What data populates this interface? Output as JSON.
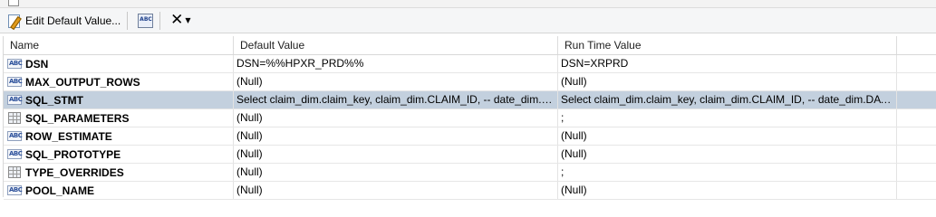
{
  "toolbar": {
    "edit_default_label": "Edit Default Value...",
    "abc_icon_text": "ABC"
  },
  "columns": {
    "name": "Name",
    "default_value": "Default Value",
    "run_time_value": "Run Time Value"
  },
  "type_icon_text": "ABC",
  "rows": [
    {
      "name": "DSN",
      "type": "string",
      "default": "DSN=%%HPXR_PRD%%",
      "runtime": "DSN=XRPRD"
    },
    {
      "name": "MAX_OUTPUT_ROWS",
      "type": "string",
      "default": "(Null)",
      "runtime": "(Null)"
    },
    {
      "name": "SQL_STMT",
      "type": "string",
      "default": "Select claim_dim.claim_key, claim_dim.CLAIM_ID, -- date_dim.DA...",
      "runtime": "Select claim_dim.claim_key, claim_dim.CLAIM_ID, -- date_dim.DATE_...",
      "selected": true
    },
    {
      "name": "SQL_PARAMETERS",
      "type": "table",
      "default": "(Null)",
      "runtime": ";"
    },
    {
      "name": "ROW_ESTIMATE",
      "type": "string",
      "default": "(Null)",
      "runtime": "(Null)"
    },
    {
      "name": "SQL_PROTOTYPE",
      "type": "string",
      "default": "(Null)",
      "runtime": "(Null)"
    },
    {
      "name": "TYPE_OVERRIDES",
      "type": "table",
      "default": "(Null)",
      "runtime": ";"
    },
    {
      "name": "POOL_NAME",
      "type": "string",
      "default": "(Null)",
      "runtime": "(Null)"
    }
  ],
  "colors": {
    "selection": "#c3d0de",
    "toolbar_bg": "#f5f6f7"
  }
}
